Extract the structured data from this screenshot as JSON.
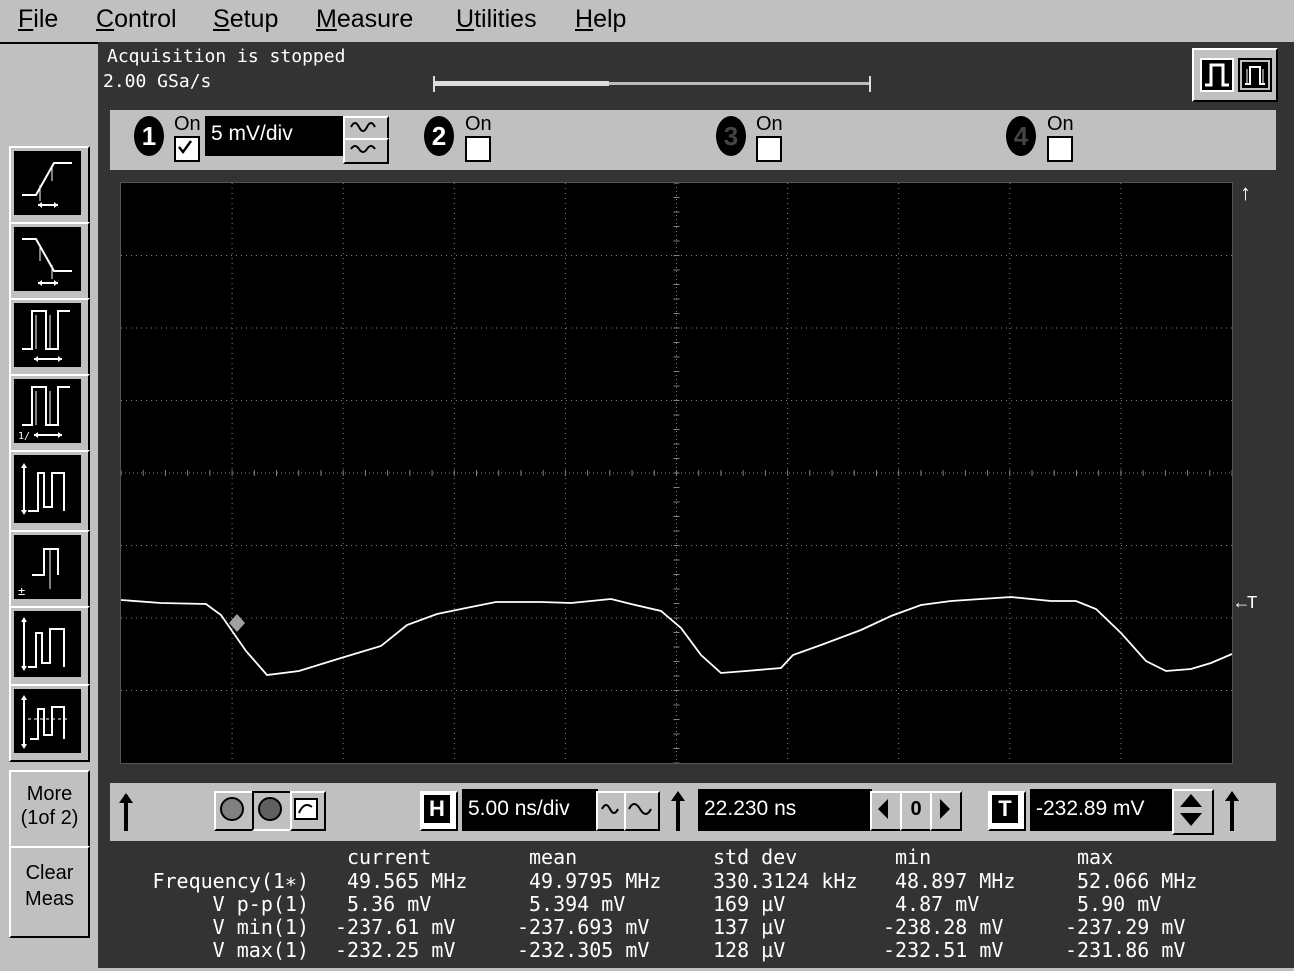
{
  "menu": {
    "items": [
      {
        "key": "F",
        "rest": "ile"
      },
      {
        "key": "C",
        "rest": "ontrol"
      },
      {
        "key": "S",
        "rest": "etup"
      },
      {
        "key": "M",
        "rest": "easure"
      },
      {
        "key": "U",
        "rest": "tilities"
      },
      {
        "key": "H",
        "rest": "elp"
      }
    ]
  },
  "status": {
    "acquisition": "Acquisition is stopped",
    "sample_rate": "2.00 GSa/s"
  },
  "channels": {
    "on_label": "On",
    "ch1": {
      "number": "1",
      "checked": true,
      "scale": "5 mV/div"
    },
    "ch2": {
      "number": "2",
      "checked": false
    },
    "ch3": {
      "number": "3",
      "checked": false
    },
    "ch4": {
      "number": "4",
      "checked": false
    }
  },
  "side": {
    "more_line1": "More",
    "more_line2": "(1of 2)",
    "clear_line1": "Clear",
    "clear_line2": "Meas"
  },
  "timebase": {
    "h_label": "H",
    "scale": "5.00 ns/div",
    "delay": "22.230 ns",
    "ref_label": "0",
    "t_label": "T",
    "trigger_level": "-232.89 mV"
  },
  "grid_markers": {
    "trigger_marker": "←T"
  },
  "measurements": {
    "headers": [
      "current",
      "mean",
      "std dev",
      "min",
      "max"
    ],
    "rows": [
      {
        "name": "Frequency(1∗)",
        "values": [
          "49.565 MHz",
          "49.9795 MHz",
          "330.3124 kHz",
          "48.897 MHz",
          "52.066 MHz"
        ]
      },
      {
        "name": "V p-p(1)",
        "values": [
          "5.36 mV",
          "5.394 mV",
          "169 µV",
          "4.87 mV",
          "5.90 mV"
        ]
      },
      {
        "name": "V min(1)",
        "values": [
          "-237.61 mV",
          "-237.693 mV",
          "137 µV",
          "-238.28 mV",
          "-237.29 mV"
        ]
      },
      {
        "name": "V max(1)",
        "values": [
          "-232.25 mV",
          "-232.305 mV",
          "128 µV",
          "-232.51 mV",
          "-231.86 mV"
        ]
      }
    ]
  },
  "colors": {
    "panel": "#333333",
    "screen": "#000000",
    "grid": "#808080",
    "trace": "#ffffff",
    "chrome": "#c0c0c0"
  }
}
